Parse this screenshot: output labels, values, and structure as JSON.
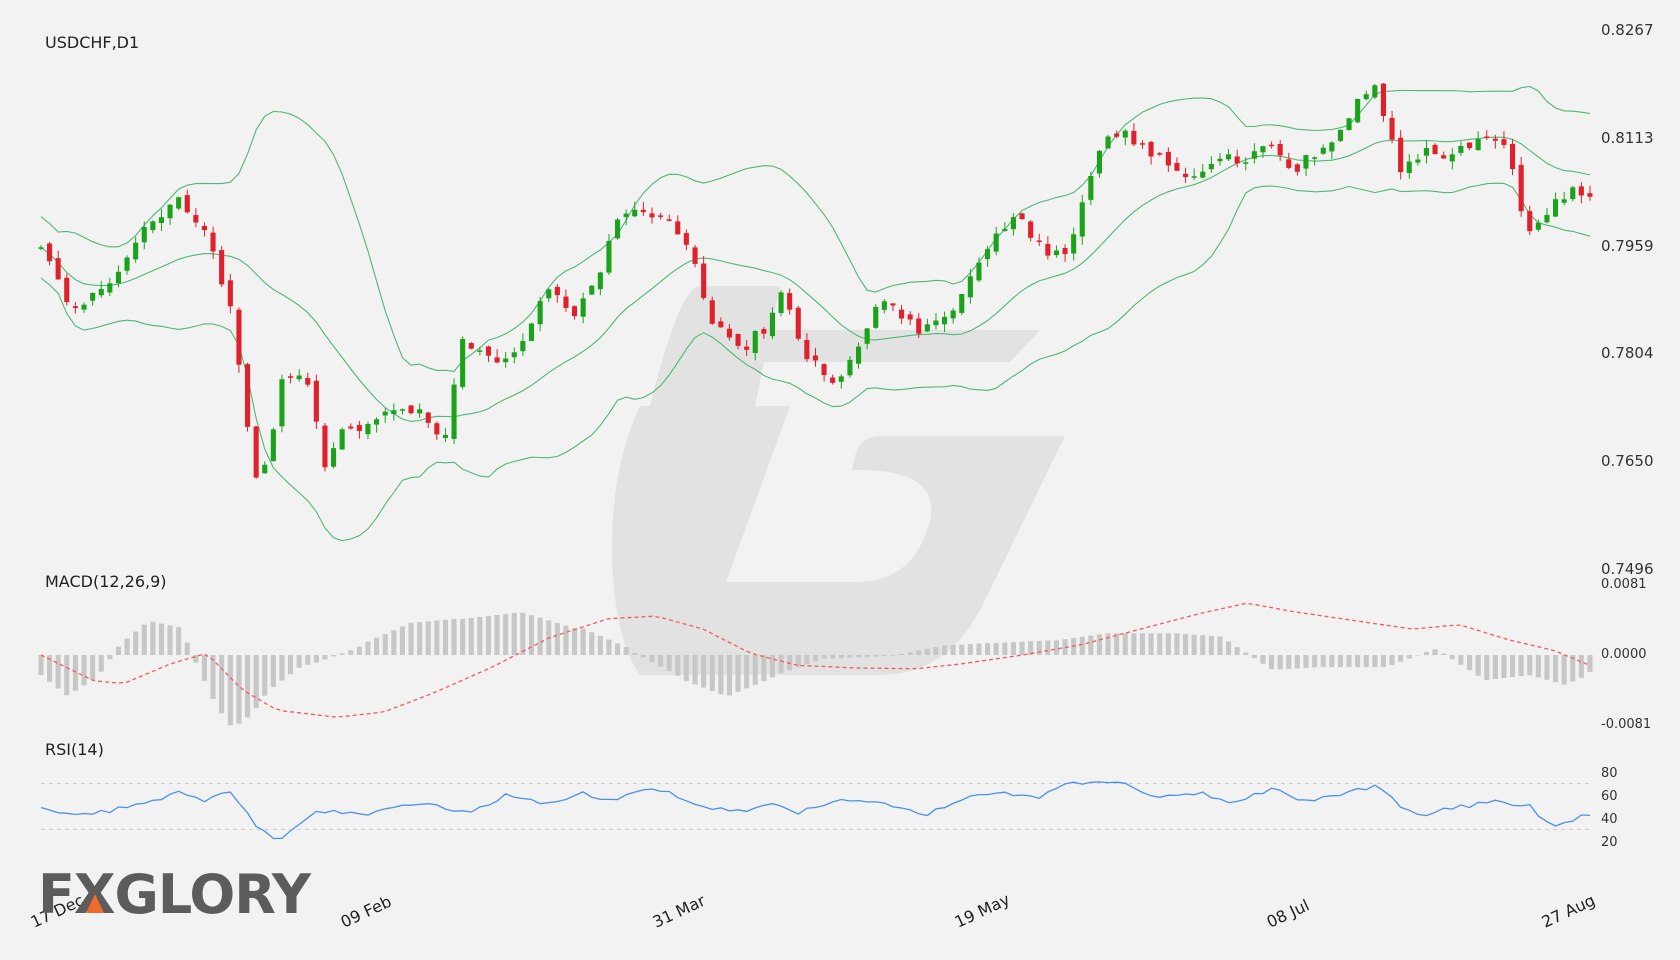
{
  "brand": {
    "logo_text": "FXGLORY",
    "accent_color": "#ef6b2c",
    "logo_color": "#5c5c5c"
  },
  "colors": {
    "bull": "#1aa31a",
    "bear": "#e0202a",
    "band": "#4fb874",
    "macd_signal": "#f25b5b",
    "macd_hist": "#c7c7c7",
    "rsi": "#4a90ee",
    "background": "#f2f2f2"
  },
  "price_panel": {
    "title": "USDCHF,D1",
    "ticks": [
      "0.8267",
      "0.8113",
      "0.7959",
      "0.7804",
      "0.7650",
      "0.7496"
    ],
    "ylim": [
      0.7496,
      0.8267
    ]
  },
  "macd_panel": {
    "title": "MACD(12,26,9)",
    "ticks": [
      "0.0081",
      "0.0000",
      "-0.0081"
    ],
    "ylim": [
      -0.0081,
      0.0081
    ]
  },
  "rsi_panel": {
    "title": "RSI(14)",
    "ticks": [
      "80",
      "60",
      "40",
      "20"
    ],
    "levels": [
      70,
      30
    ],
    "ylim": [
      20,
      80
    ]
  },
  "x_axis": {
    "labels": [
      "17 Dec",
      "09 Feb",
      "31 Mar",
      "19 May",
      "08 Jul",
      "27 Aug"
    ],
    "label_index": [
      0,
      38,
      74,
      109,
      144,
      180
    ]
  },
  "chart_data": {
    "type": "candlestick",
    "symbol": "USDCHF",
    "timeframe": "D1",
    "num_bars": 181,
    "anchor_closes": [
      [
        0,
        0.7955
      ],
      [
        5,
        0.7865
      ],
      [
        11,
        0.791
      ],
      [
        17,
        0.799
      ],
      [
        22,
        0.8025
      ],
      [
        26,
        0.798
      ],
      [
        30,
        0.787
      ],
      [
        34,
        0.7615
      ],
      [
        36,
        0.765
      ],
      [
        38,
        0.776
      ],
      [
        42,
        0.778
      ],
      [
        45,
        0.7645
      ],
      [
        48,
        0.769
      ],
      [
        52,
        0.77
      ],
      [
        56,
        0.773
      ],
      [
        60,
        0.772
      ],
      [
        64,
        0.768
      ],
      [
        67,
        0.782
      ],
      [
        72,
        0.779
      ],
      [
        77,
        0.782
      ],
      [
        80,
        0.79
      ],
      [
        85,
        0.786
      ],
      [
        88,
        0.79
      ],
      [
        92,
        0.801
      ],
      [
        97,
        0.8005
      ],
      [
        100,
        0.799
      ],
      [
        103,
        0.795
      ],
      [
        107,
        0.784
      ],
      [
        112,
        0.7815
      ],
      [
        115,
        0.784
      ],
      [
        118,
        0.79
      ],
      [
        121,
        0.78
      ],
      [
        124,
        0.778
      ],
      [
        127,
        0.776
      ],
      [
        131,
        0.784
      ],
      [
        134,
        0.788
      ],
      [
        137,
        0.785
      ],
      [
        140,
        0.783
      ],
      [
        144,
        0.786
      ],
      [
        147,
        0.79
      ],
      [
        150,
        0.795
      ],
      [
        155,
        0.8
      ],
      [
        160,
        0.7945
      ],
      [
        163,
        0.794
      ],
      [
        165,
        0.8015
      ],
      [
        168,
        0.81
      ],
      [
        172,
        0.812
      ],
      [
        176,
        0.809
      ],
      [
        180,
        0.807
      ],
      [
        184,
        0.8055
      ],
      [
        188,
        0.808
      ],
      [
        192,
        0.8085
      ],
      [
        195,
        0.8115
      ],
      [
        198,
        0.806
      ],
      [
        201,
        0.808
      ],
      [
        205,
        0.81
      ],
      [
        209,
        0.817
      ],
      [
        212,
        0.8185
      ],
      [
        216,
        0.8065
      ],
      [
        220,
        0.809
      ],
      [
        223,
        0.8085
      ],
      [
        226,
        0.81
      ],
      [
        230,
        0.8115
      ],
      [
        233,
        0.8095
      ],
      [
        236,
        0.7965
      ],
      [
        239,
        0.8
      ],
      [
        243,
        0.804
      ],
      [
        246,
        0.803
      ]
    ],
    "macd": {
      "signal_anchors": [
        [
          0,
          0.0
        ],
        [
          9,
          -0.003
        ],
        [
          14,
          -0.0033
        ],
        [
          22,
          -0.001
        ],
        [
          28,
          0.0002
        ],
        [
          34,
          -0.004
        ],
        [
          40,
          -0.0064
        ],
        [
          50,
          -0.0072
        ],
        [
          58,
          -0.0066
        ],
        [
          66,
          -0.0045
        ],
        [
          76,
          -0.0015
        ],
        [
          86,
          0.002
        ],
        [
          96,
          0.0042
        ],
        [
          104,
          0.0045
        ],
        [
          112,
          0.003
        ],
        [
          120,
          0.0002
        ],
        [
          128,
          -0.0012
        ],
        [
          138,
          -0.0015
        ],
        [
          148,
          -0.0016
        ],
        [
          156,
          -0.001
        ],
        [
          166,
          0.0
        ],
        [
          176,
          0.0012
        ],
        [
          186,
          0.003
        ],
        [
          196,
          0.0048
        ],
        [
          204,
          0.006
        ],
        [
          212,
          0.005
        ],
        [
          222,
          0.004
        ],
        [
          232,
          0.003
        ],
        [
          240,
          0.0035
        ],
        [
          248,
          0.0018
        ],
        [
          256,
          0.0005
        ],
        [
          262,
          -0.0012
        ]
      ]
    },
    "rsi": {
      "anchors": [
        [
          0,
          48
        ],
        [
          6,
          41
        ],
        [
          14,
          50
        ],
        [
          22,
          62
        ],
        [
          26,
          55
        ],
        [
          30,
          65
        ],
        [
          34,
          35
        ],
        [
          38,
          20
        ],
        [
          44,
          46
        ],
        [
          52,
          44
        ],
        [
          60,
          52
        ],
        [
          68,
          45
        ],
        [
          74,
          60
        ],
        [
          80,
          53
        ],
        [
          86,
          62
        ],
        [
          90,
          55
        ],
        [
          96,
          66
        ],
        [
          100,
          62
        ],
        [
          104,
          52
        ],
        [
          110,
          45
        ],
        [
          116,
          52
        ],
        [
          120,
          44
        ],
        [
          126,
          55
        ],
        [
          134,
          53
        ],
        [
          140,
          42
        ],
        [
          146,
          55
        ],
        [
          152,
          64
        ],
        [
          158,
          57
        ],
        [
          162,
          68
        ],
        [
          168,
          72
        ],
        [
          172,
          69
        ],
        [
          178,
          58
        ],
        [
          184,
          62
        ],
        [
          190,
          53
        ],
        [
          196,
          67
        ],
        [
          200,
          55
        ],
        [
          206,
          60
        ],
        [
          212,
          68
        ],
        [
          218,
          42
        ],
        [
          224,
          48
        ],
        [
          230,
          54
        ],
        [
          236,
          52
        ],
        [
          240,
          33
        ],
        [
          246,
          44
        ]
      ]
    },
    "xlim": [
      0,
      180
    ]
  }
}
